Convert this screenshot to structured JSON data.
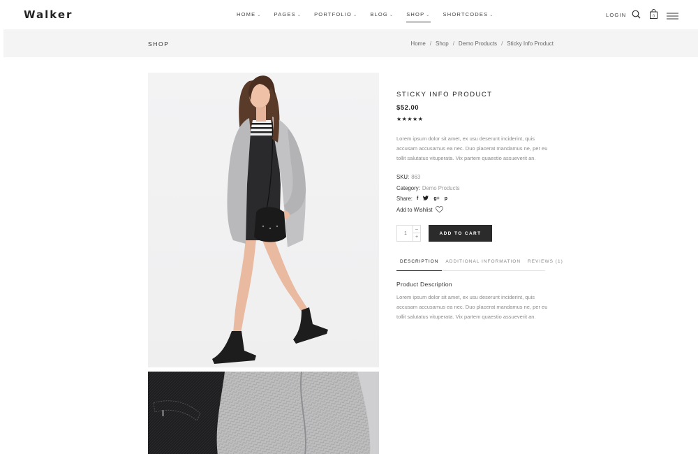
{
  "header": {
    "logo": "Walker",
    "nav": [
      {
        "label": "HOME",
        "active": false
      },
      {
        "label": "PAGES",
        "active": false
      },
      {
        "label": "PORTFOLIO",
        "active": false
      },
      {
        "label": "BLOG",
        "active": false
      },
      {
        "label": "SHOP",
        "active": true
      },
      {
        "label": "SHORTCODES",
        "active": false
      }
    ],
    "login_label": "LOGIN",
    "cart_count": "0"
  },
  "titlebar": {
    "title": "SHOP",
    "breadcrumb": [
      "Home",
      "Shop",
      "Demo Products",
      "Sticky Info Product"
    ]
  },
  "product": {
    "title": "STICKY INFO PRODUCT",
    "price": "$52.00",
    "rating": 5,
    "rating_stars": "★★★★★",
    "short_description": "Lorem ipsum dolor sit amet, ex usu deserunt inciderint, quis accusam accusamus ea nec. Duo placerat mandamus ne, per eu tollit salutatus vituperata. Vix partem quaestio assueverit an.",
    "sku_label": "SKU:",
    "sku": "863",
    "category_label": "Category:",
    "category": "Demo Products",
    "share_label": "Share:",
    "share_icons": [
      "f",
      "t",
      "g+",
      "p"
    ],
    "wishlist_label": "Add to Wishlist",
    "quantity": "1",
    "add_to_cart_label": "ADD TO CART"
  },
  "tabs": [
    {
      "label": "DESCRIPTION",
      "active": true
    },
    {
      "label": "ADDITIONAL INFORMATION",
      "active": false
    },
    {
      "label": "REVIEWS (1)",
      "active": false
    }
  ],
  "tab_panel": {
    "heading": "Product Description",
    "text": "Lorem ipsum dolor sit amet, ex usu deserunt inciderint, quis accusam accusamus ea nec. Duo placerat mandamus ne, per eu tollit salutatus vituperata. Vix partem quaestio assueverit an."
  },
  "colors": {
    "accent": "#2b2b2b",
    "titlebar_bg": "#f4f4f5"
  }
}
